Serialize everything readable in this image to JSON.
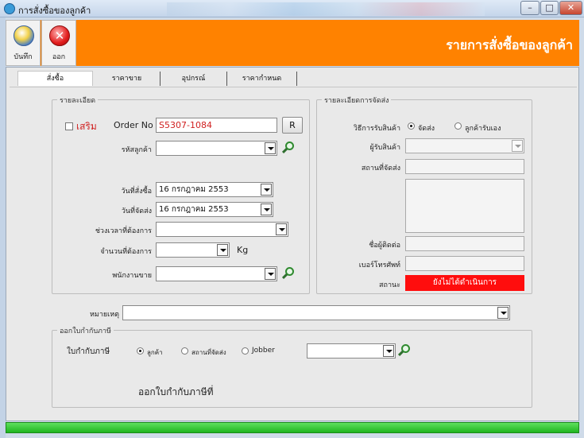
{
  "window": {
    "title": "การสั่งซื้อของลูกค้า"
  },
  "toolbar": {
    "save_label": "บันทึก",
    "exit_label": "ออก",
    "app_title": "รายการสั่งซื้อของลูกค้า"
  },
  "tabs": [
    {
      "label": "สั่งซื้อ"
    },
    {
      "label": "ราคาขาย"
    },
    {
      "label": "อุปกรณ์"
    },
    {
      "label": "ราคากำหนด"
    }
  ],
  "details": {
    "group_title": "รายละเอียด",
    "extra_label": "เสริม",
    "order_no_label": "Order No",
    "order_no_value": "S5307-1084",
    "refresh_label": "R",
    "customer_code_label": "รหัสลูกค้า",
    "customer_code_value": "",
    "order_date_label": "วันที่สั่งซื้อ",
    "order_date_value": "16 กรกฎาคม  2553",
    "ship_date_label": "วันที่จัดส่ง",
    "ship_date_value": "16 กรกฎาคม  2553",
    "time_needed_label": "ช่วงเวลาที่ต้องการ",
    "time_needed_value": "",
    "qty_label": "จำนวนที่ต้องการ",
    "qty_value": "",
    "qty_unit": "Kg",
    "salesman_label": "พนักงานขาย",
    "salesman_value": ""
  },
  "shipping": {
    "group_title": "รายละเอียดการจัดส่ง",
    "method_label": "วิธีการรับสินค้า",
    "method_options": [
      "จัดส่ง",
      "ลูกค้ารับเอง"
    ],
    "method_selected": "จัดส่ง",
    "receiver_label": "ผู้รับสินค้า",
    "receiver_value": "",
    "place_label": "สถานที่จัดส่ง",
    "place_value": "",
    "address_value": "",
    "contact_label": "ชื่อผู้ติดต่อ",
    "contact_value": "",
    "phone_label": "เบอร์โทรศัพท์",
    "phone_value": "",
    "status_label": "สถานะ",
    "status_value": "ยังไม่ได้ดำเนินการ"
  },
  "remarks": {
    "label": "หมายเหตุ",
    "value": ""
  },
  "invoice": {
    "group_title": "ออกใบกำกับภาษี",
    "tax_label": "ใบกำกับภาษี",
    "options": [
      "ลูกค้า",
      "สถานที่จัดส่ง",
      "Jobber"
    ],
    "selected": "ลูกค้า",
    "jobber_value": "",
    "issue_label": "ออกใบกำกับภาษีที่"
  },
  "colors": {
    "toolbar": "#ff8200",
    "status": "#ff0d0d",
    "footer": "#1fb51f",
    "order_no_text": "#d01f1f"
  }
}
